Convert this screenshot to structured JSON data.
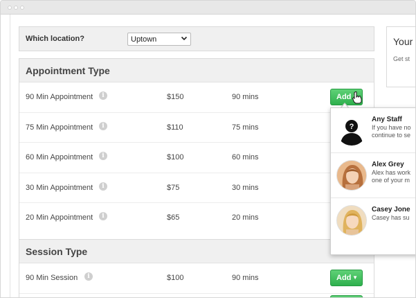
{
  "location": {
    "label": "Which location?",
    "selected": "Uptown"
  },
  "appointments": {
    "title": "Appointment Type",
    "rows": [
      {
        "name": "90 Min Appointment",
        "price": "$150",
        "duration": "90 mins"
      },
      {
        "name": "75 Min Appointment",
        "price": "$110",
        "duration": "75 mins"
      },
      {
        "name": "60 Min Appointment",
        "price": "$100",
        "duration": "60 mins"
      },
      {
        "name": "30 Min Appointment",
        "price": "$75",
        "duration": "30 mins"
      },
      {
        "name": "20 Min Appointment",
        "price": "$65",
        "duration": "20 mins"
      }
    ]
  },
  "sessions": {
    "title": "Session Type",
    "rows": [
      {
        "name": "90 Min Session",
        "price": "$100",
        "duration": "90 mins"
      }
    ]
  },
  "buttons": {
    "add_label": "Add"
  },
  "side_panel": {
    "title": "Your",
    "subtitle": "Get st"
  },
  "staff_menu": {
    "items": [
      {
        "name": "Any Staff",
        "desc_line1": "If you have no",
        "desc_line2": "continue to se"
      },
      {
        "name": "Alex Grey",
        "desc_line1": "Alex has work",
        "desc_line2": "one of your m"
      },
      {
        "name": "Casey Jone",
        "desc_line1": "Casey has su",
        "desc_line2": ""
      }
    ]
  },
  "colors": {
    "add_button": "#3dbb58",
    "section_header_bg": "#f0f0f0"
  }
}
